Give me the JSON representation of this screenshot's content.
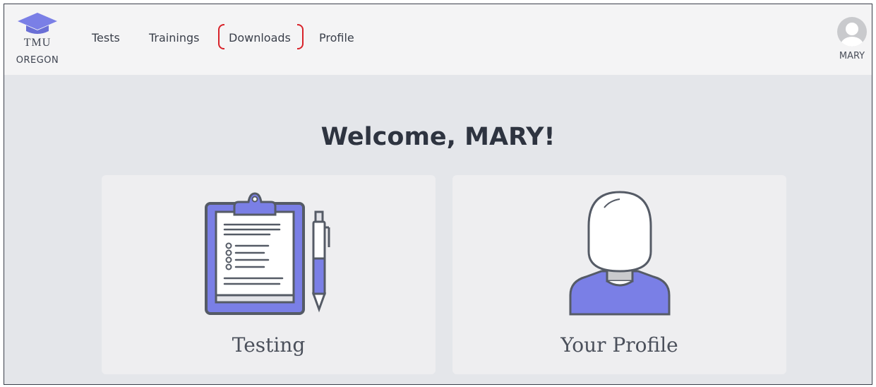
{
  "brand": {
    "logo_text": "TMU",
    "sub_text": "OREGON"
  },
  "nav": {
    "items": [
      {
        "label": "Tests"
      },
      {
        "label": "Trainings"
      },
      {
        "label": "Downloads",
        "highlighted": true
      },
      {
        "label": "Profile"
      }
    ]
  },
  "user": {
    "name": "MARY",
    "icon": "user-avatar-icon"
  },
  "main": {
    "welcome": "Welcome, MARY!",
    "cards": [
      {
        "label": "Testing",
        "icon": "clipboard-pen-icon"
      },
      {
        "label": "Your Profile",
        "icon": "person-silhouette-icon"
      }
    ]
  },
  "colors": {
    "accent": "#7a7fe6",
    "outline": "#555b66",
    "highlight_annotation": "#d8232a",
    "nav_bg": "#f4f4f5",
    "page_bg": "#e4e6ea",
    "card_bg": "#eeeef0"
  }
}
